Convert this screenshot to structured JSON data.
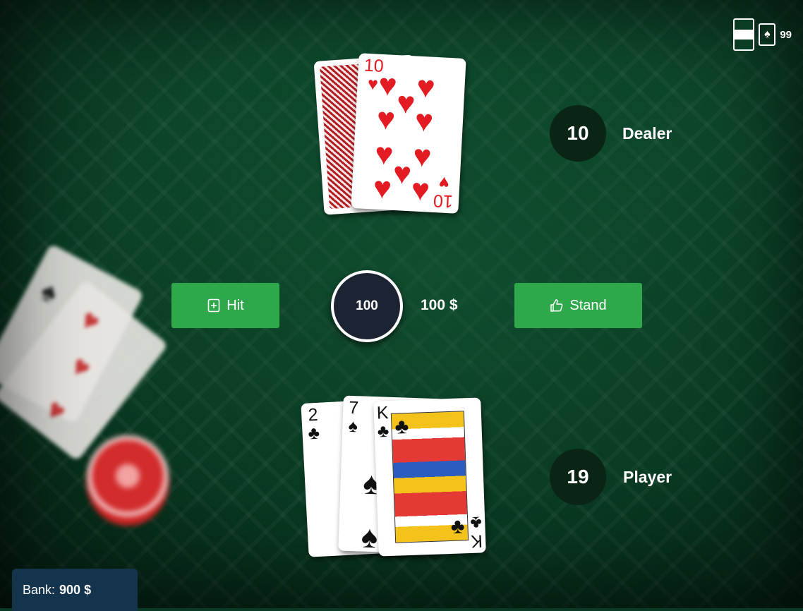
{
  "deck": {
    "remaining": "99"
  },
  "dealer": {
    "label": "Dealer",
    "score": "10",
    "cards": [
      {
        "face_down": true
      },
      {
        "rank": "10",
        "suit": "♥",
        "color": "red"
      }
    ]
  },
  "player": {
    "label": "Player",
    "score": "19",
    "cards": [
      {
        "rank": "2",
        "suit": "♣",
        "color": "black"
      },
      {
        "rank": "7",
        "suit": "♠",
        "color": "black"
      },
      {
        "rank": "K",
        "suit": "♣",
        "color": "black"
      }
    ]
  },
  "actions": {
    "hit_label": "Hit",
    "stand_label": "Stand"
  },
  "bet": {
    "chip_value": "100",
    "amount": "100 $"
  },
  "bank": {
    "label": "Bank:",
    "amount": "900 $"
  },
  "colors": {
    "button": "#2ea84a",
    "felt": "#0b3a24",
    "bank_panel": "#14334d",
    "chip": "#1c2433"
  }
}
